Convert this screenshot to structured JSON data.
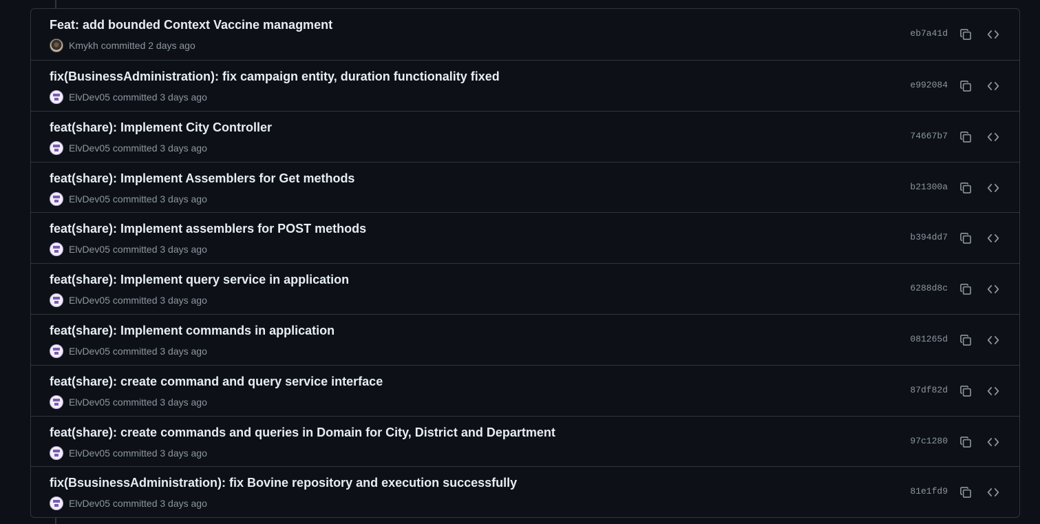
{
  "commits": [
    {
      "title": "Feat: add bounded Context Vaccine managment",
      "author": "Kmykh",
      "meta": "committed 2 days ago",
      "sha": "eb7a41d",
      "avatar": "kmykh"
    },
    {
      "title": "fix(BusinessAdministration): fix campaign entity, duration functionality fixed",
      "author": "ElvDev05",
      "meta": "committed 3 days ago",
      "sha": "e992084",
      "avatar": "elv"
    },
    {
      "title": "feat(share): Implement City Controller",
      "author": "ElvDev05",
      "meta": "committed 3 days ago",
      "sha": "74667b7",
      "avatar": "elv"
    },
    {
      "title": "feat(share): Implement Assemblers for Get methods",
      "author": "ElvDev05",
      "meta": "committed 3 days ago",
      "sha": "b21300a",
      "avatar": "elv"
    },
    {
      "title": "feat(share): Implement assemblers for POST methods",
      "author": "ElvDev05",
      "meta": "committed 3 days ago",
      "sha": "b394dd7",
      "avatar": "elv"
    },
    {
      "title": "feat(share): Implement query service in application",
      "author": "ElvDev05",
      "meta": "committed 3 days ago",
      "sha": "6288d8c",
      "avatar": "elv"
    },
    {
      "title": "feat(share): Implement commands in application",
      "author": "ElvDev05",
      "meta": "committed 3 days ago",
      "sha": "081265d",
      "avatar": "elv"
    },
    {
      "title": "feat(share): create command and query service interface",
      "author": "ElvDev05",
      "meta": "committed 3 days ago",
      "sha": "87df82d",
      "avatar": "elv"
    },
    {
      "title": "feat(share): create commands and queries in Domain for City, District and Department",
      "author": "ElvDev05",
      "meta": "committed 3 days ago",
      "sha": "97c1280",
      "avatar": "elv"
    },
    {
      "title": "fix(BsusinessAdministration): fix Bovine repository and execution successfully",
      "author": "ElvDev05",
      "meta": "committed 3 days ago",
      "sha": "81e1fd9",
      "avatar": "elv"
    }
  ],
  "icons": {
    "copy": "copy-icon",
    "browse": "code-icon"
  },
  "colors": {
    "background": "#0d1117",
    "border": "#30363d",
    "title": "#e6edf3",
    "muted": "#8d96a0"
  }
}
